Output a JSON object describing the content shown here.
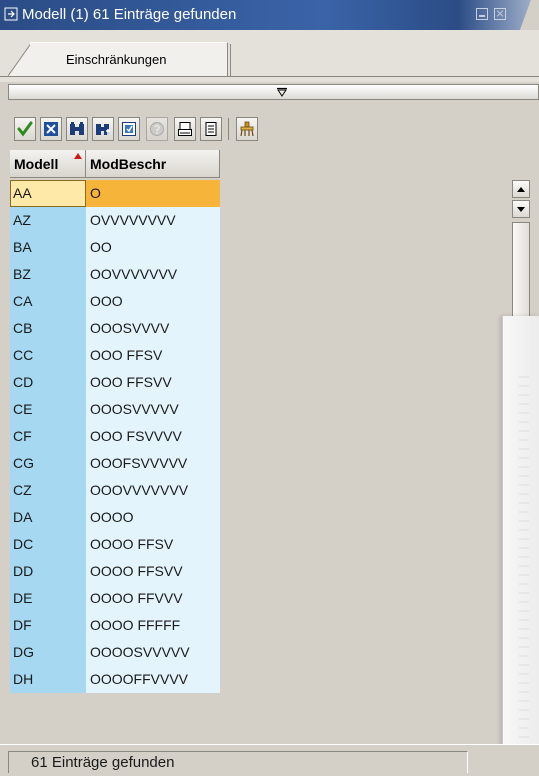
{
  "window": {
    "title": "Modell (1)  61 Einträge gefunden"
  },
  "tabs": [
    {
      "label": "Einschränkungen",
      "active": true
    }
  ],
  "toolbar": {
    "buttons": [
      {
        "icon": "checkmark-icon"
      },
      {
        "icon": "cancel-icon"
      },
      {
        "icon": "find-icon"
      },
      {
        "icon": "find-next-icon"
      },
      {
        "icon": "select-icon"
      },
      {
        "icon": "help-icon",
        "disabled": true
      },
      {
        "icon": "print-icon"
      },
      {
        "icon": "list-icon"
      },
      {
        "icon": "filter-icon"
      }
    ]
  },
  "table": {
    "columns": [
      {
        "label": "Modell",
        "sorted": "ascending"
      },
      {
        "label": "ModBeschr"
      }
    ],
    "rows": [
      {
        "modell": "AA",
        "beschr": "O"
      },
      {
        "modell": "AZ",
        "beschr": "OVVVVVVVV"
      },
      {
        "modell": "BA",
        "beschr": "OO"
      },
      {
        "modell": "BZ",
        "beschr": "OOVVVVVVV"
      },
      {
        "modell": "CA",
        "beschr": "OOO"
      },
      {
        "modell": "CB",
        "beschr": "OOOSVVVV"
      },
      {
        "modell": "CC",
        "beschr": "OOO  FFSV"
      },
      {
        "modell": "CD",
        "beschr": "OOO  FFSVV"
      },
      {
        "modell": "CE",
        "beschr": "OOOSVVVVV"
      },
      {
        "modell": "CF",
        "beschr": "OOO FSVVVV"
      },
      {
        "modell": "CG",
        "beschr": "OOOFSVVVVV"
      },
      {
        "modell": "CZ",
        "beschr": "OOOVVVVVVV"
      },
      {
        "modell": "DA",
        "beschr": "OOOO"
      },
      {
        "modell": "DC",
        "beschr": "OOOO FFSV"
      },
      {
        "modell": "DD",
        "beschr": "OOOO FFSVV"
      },
      {
        "modell": "DE",
        "beschr": "OOOO FFVVV"
      },
      {
        "modell": "DF",
        "beschr": "OOOO FFFFF"
      },
      {
        "modell": "DG",
        "beschr": "OOOOSVVVVV"
      },
      {
        "modell": "DH",
        "beschr": "OOOOFFVVVV"
      }
    ],
    "selected_row_index": 0
  },
  "status": {
    "message": "61 Einträge gefunden"
  },
  "colors": {
    "title_bar": "#2b4c86",
    "key_column": "#a6d8f2",
    "value_column": "#e4f4fd",
    "selected_row": "#f6b43b"
  }
}
